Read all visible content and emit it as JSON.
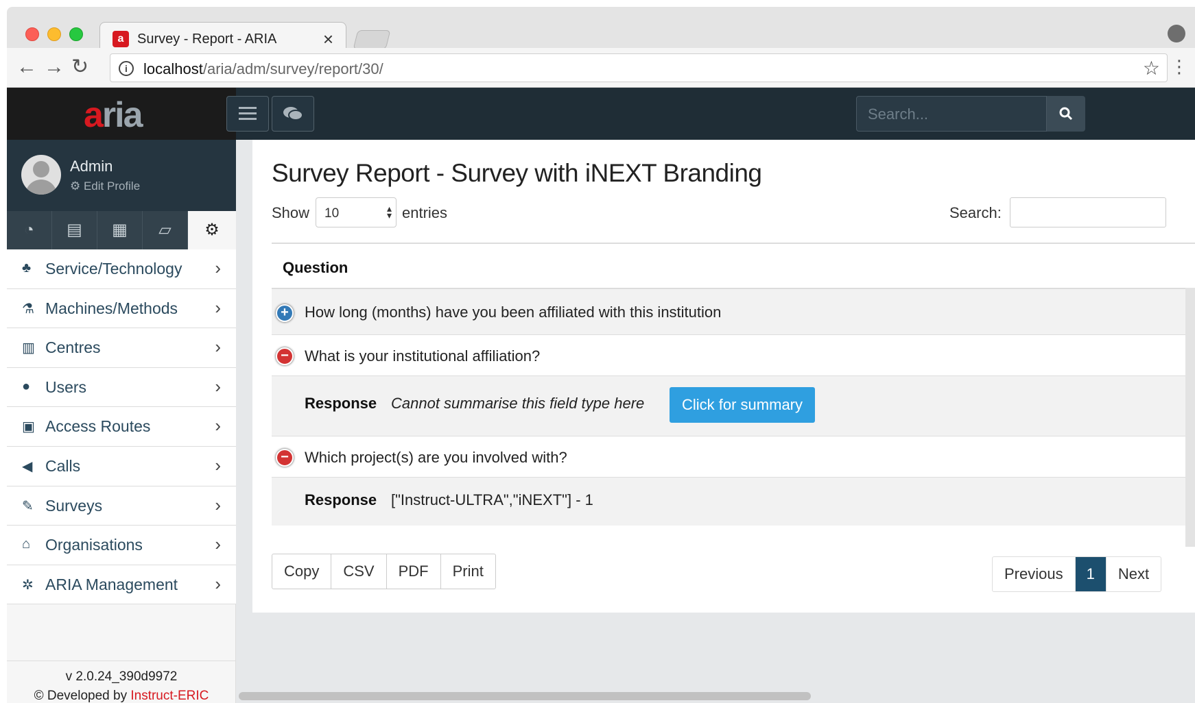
{
  "browser": {
    "tab_title": "Survey - Report - ARIA",
    "tab_close": "×",
    "url_host": "localhost",
    "url_path": "/aria/adm/survey/report/30/"
  },
  "app": {
    "brand_a": "a",
    "brand_rest": "ria",
    "search_placeholder": "Search..."
  },
  "user": {
    "name": "Admin",
    "edit_profile": "⚙ Edit Profile"
  },
  "sidebar": {
    "items": [
      {
        "icon": "sitemap-icon",
        "label": "Service/Technology"
      },
      {
        "icon": "flask-icon",
        "label": "Machines/Methods"
      },
      {
        "icon": "building-icon",
        "label": "Centres"
      },
      {
        "icon": "users-icon",
        "label": "Users"
      },
      {
        "icon": "money-icon",
        "label": "Access Routes"
      },
      {
        "icon": "bullhorn-icon",
        "label": "Calls"
      },
      {
        "icon": "edit-icon",
        "label": "Surveys"
      },
      {
        "icon": "institution-icon",
        "label": "Organisations"
      },
      {
        "icon": "cogs-icon",
        "label": "ARIA Management"
      }
    ],
    "version": "v 2.0.24_390d9972",
    "developed_by_prefix": "© Developed by ",
    "developed_by_link": "Instruct-ERIC"
  },
  "report": {
    "title": "Survey Report - Survey with iNEXT Branding",
    "show_label": "Show",
    "page_length": "10",
    "entries_label": "entries",
    "search_label": "Search:",
    "column_header": "Question",
    "rows": [
      {
        "question": "How long (months) have you been affiliated with this institution",
        "expanded": false
      },
      {
        "question": "What is your institutional affiliation?",
        "expanded": true,
        "response_label": "Response",
        "response_text": "Cannot summarise this field type here",
        "button": "Click for summary"
      },
      {
        "question": "Which project(s) are you involved with?",
        "expanded": true,
        "response_label": "Response",
        "response_text": "[\"Instruct-ULTRA\",\"iNEXT\"] - 1"
      }
    ],
    "export_buttons": [
      "Copy",
      "CSV",
      "PDF",
      "Print"
    ],
    "pagination": {
      "previous": "Previous",
      "current": "1",
      "next": "Next"
    }
  },
  "colors": {
    "brand_red": "#d71920",
    "navbar": "#1f2d36",
    "summary_button": "#2f9fe0",
    "page_active": "#1c4f6e"
  }
}
